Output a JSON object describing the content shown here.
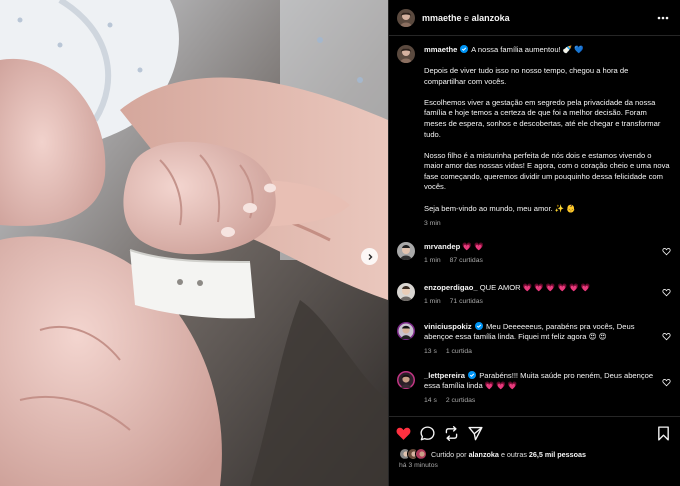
{
  "header": {
    "user1": "mmaethe",
    "separator": "e",
    "user2": "alanzoka",
    "more_icon": "more-horizontal-icon"
  },
  "caption": {
    "username": "mmaethe",
    "first_line": "A nossa família aumentou! 🍼 💙",
    "paragraphs": [
      "Depois de viver tudo isso no nosso tempo, chegou a hora de compartilhar com vocês.",
      "Escolhemos viver a gestação em segredo pela privacidade da nossa família e hoje temos a certeza de que foi a melhor decisão. Foram meses de espera, sonhos e descobertas, até ele chegar e transformar tudo.",
      "Nosso filho é a misturinha perfeita de nós dois e estamos vivendo o maior amor das nossas vidas! E agora, com o coração cheio e uma nova fase começando, queremos dividir um pouquinho dessa felicidade com vocês.",
      "Seja bem-vindo ao mundo, meu amor. ✨ 👶"
    ],
    "time": "3 min"
  },
  "comments": [
    {
      "username": "mrvandep",
      "verified": false,
      "text": "💗 💗",
      "time": "1 min",
      "likes": "87 curtidas",
      "reply": ""
    },
    {
      "username": "enzoperdigao_",
      "verified": false,
      "text": "QUE AMOR 💗 💗 💗 💗 💗 💗",
      "time": "1 min",
      "likes": "71 curtidas",
      "reply": ""
    },
    {
      "username": "viniciuspokiz",
      "verified": true,
      "text": "Meu Deeeeeeus, parabéns pra vocês, Deus abençoe essa família linda. Fiquei mt feliz agora 😍 😍",
      "time": "13 s",
      "likes": "1 curtida",
      "reply": ""
    },
    {
      "username": "_lettpereira",
      "verified": true,
      "text": "Parabéns!!! Muita saúde pro neném, Deus abençoe essa família linda 💗 💗 💗",
      "time": "14 s",
      "likes": "2 curtidas",
      "reply": ""
    }
  ],
  "likes": {
    "prefix": "Curtido por",
    "user": "alanzoka",
    "suffix": "e outras",
    "count": "26,5 mil pessoas"
  },
  "posted": "há 3 minutos",
  "icons": [
    "heart-icon",
    "comment-icon",
    "share-icon",
    "send-icon",
    "bookmark-icon",
    "chevron-right-icon",
    "verified-badge-icon"
  ],
  "colors": {
    "like_red": "#ff3040",
    "verified_blue": "#0095f6",
    "muted_text": "#a8a8a8",
    "background": "#000000"
  }
}
